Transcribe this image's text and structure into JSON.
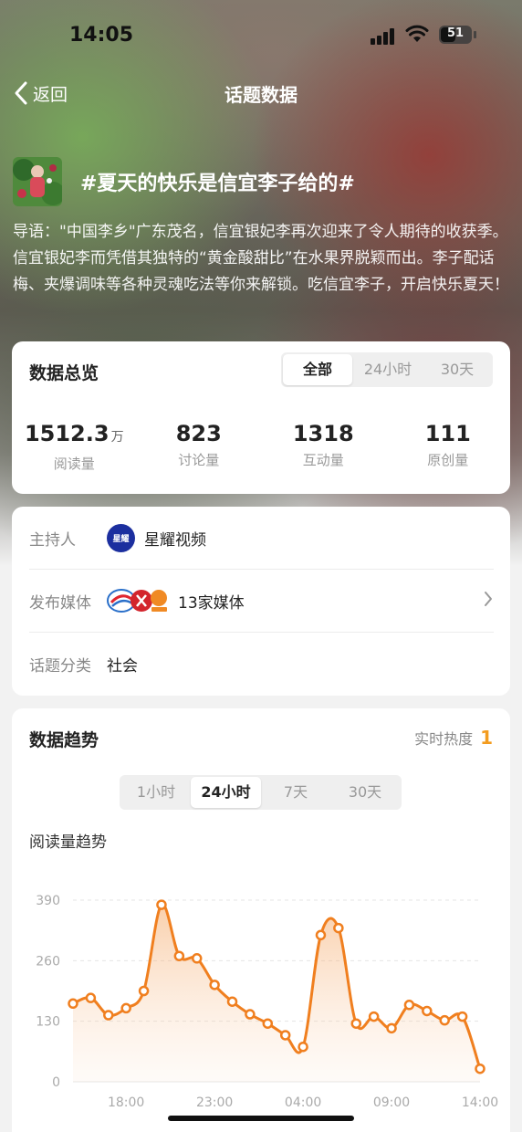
{
  "status_bar": {
    "time": "14:05",
    "battery": "51",
    "battery_level": 0.51
  },
  "nav": {
    "back_label": "返回",
    "title": "话题数据"
  },
  "topic": {
    "title": "#夏天的快乐是信宜李子给的#",
    "intro": "导语：\"中国李乡\"广东茂名，信宜银妃李再次迎来了令人期待的收获季。信宜银妃李而凭借其独特的“黄金酸甜比”在水果界脱颖而出。李子配话梅、夹爆调味等各种灵魂吃法等你来解锁。吃信宜李子，开启快乐夏天！"
  },
  "overview": {
    "title": "数据总览",
    "tabs": [
      "全部",
      "24小时",
      "30天"
    ],
    "active_tab": 0,
    "stats": [
      {
        "value": "1512.3",
        "unit": "万",
        "label": "阅读量"
      },
      {
        "value": "823",
        "unit": "",
        "label": "讨论量"
      },
      {
        "value": "1318",
        "unit": "",
        "label": "互动量"
      },
      {
        "value": "111",
        "unit": "",
        "label": "原创量"
      }
    ]
  },
  "info": {
    "host_label": "主持人",
    "host_name": "星耀视频",
    "host_logo_text": "星耀",
    "media_label": "发布媒体",
    "media_value": "13家媒体",
    "category_label": "话题分类",
    "category_value": "社会"
  },
  "trend": {
    "title": "数据趋势",
    "hot_label": "实时热度",
    "hot_value": "1",
    "tabs": [
      "1小时",
      "24小时",
      "7天",
      "30天"
    ],
    "active_tab": 1,
    "chart_title": "阅读量趋势"
  },
  "colors": {
    "accent": "#f07f1f",
    "hot": "#f39c1f"
  },
  "chart_data": {
    "type": "area",
    "title": "阅读量趋势",
    "x_ticks": [
      "18:00",
      "23:00",
      "04:00",
      "09:00",
      "14:00"
    ],
    "y_ticks": [
      0,
      130,
      260,
      390
    ],
    "ylim": [
      0,
      390
    ],
    "x": [
      "15:00",
      "16:00",
      "17:00",
      "18:00",
      "19:00",
      "20:00",
      "21:00",
      "22:00",
      "23:00",
      "00:00",
      "01:00",
      "02:00",
      "03:00",
      "04:00",
      "05:00",
      "06:00",
      "07:00",
      "08:00",
      "09:00",
      "10:00",
      "11:00",
      "12:00",
      "13:00",
      "14:00"
    ],
    "values": [
      168,
      180,
      143,
      158,
      195,
      380,
      270,
      265,
      208,
      172,
      145,
      125,
      100,
      75,
      315,
      330,
      125,
      140,
      115,
      165,
      152,
      132,
      140,
      28
    ],
    "grid": true,
    "legend": "none"
  }
}
